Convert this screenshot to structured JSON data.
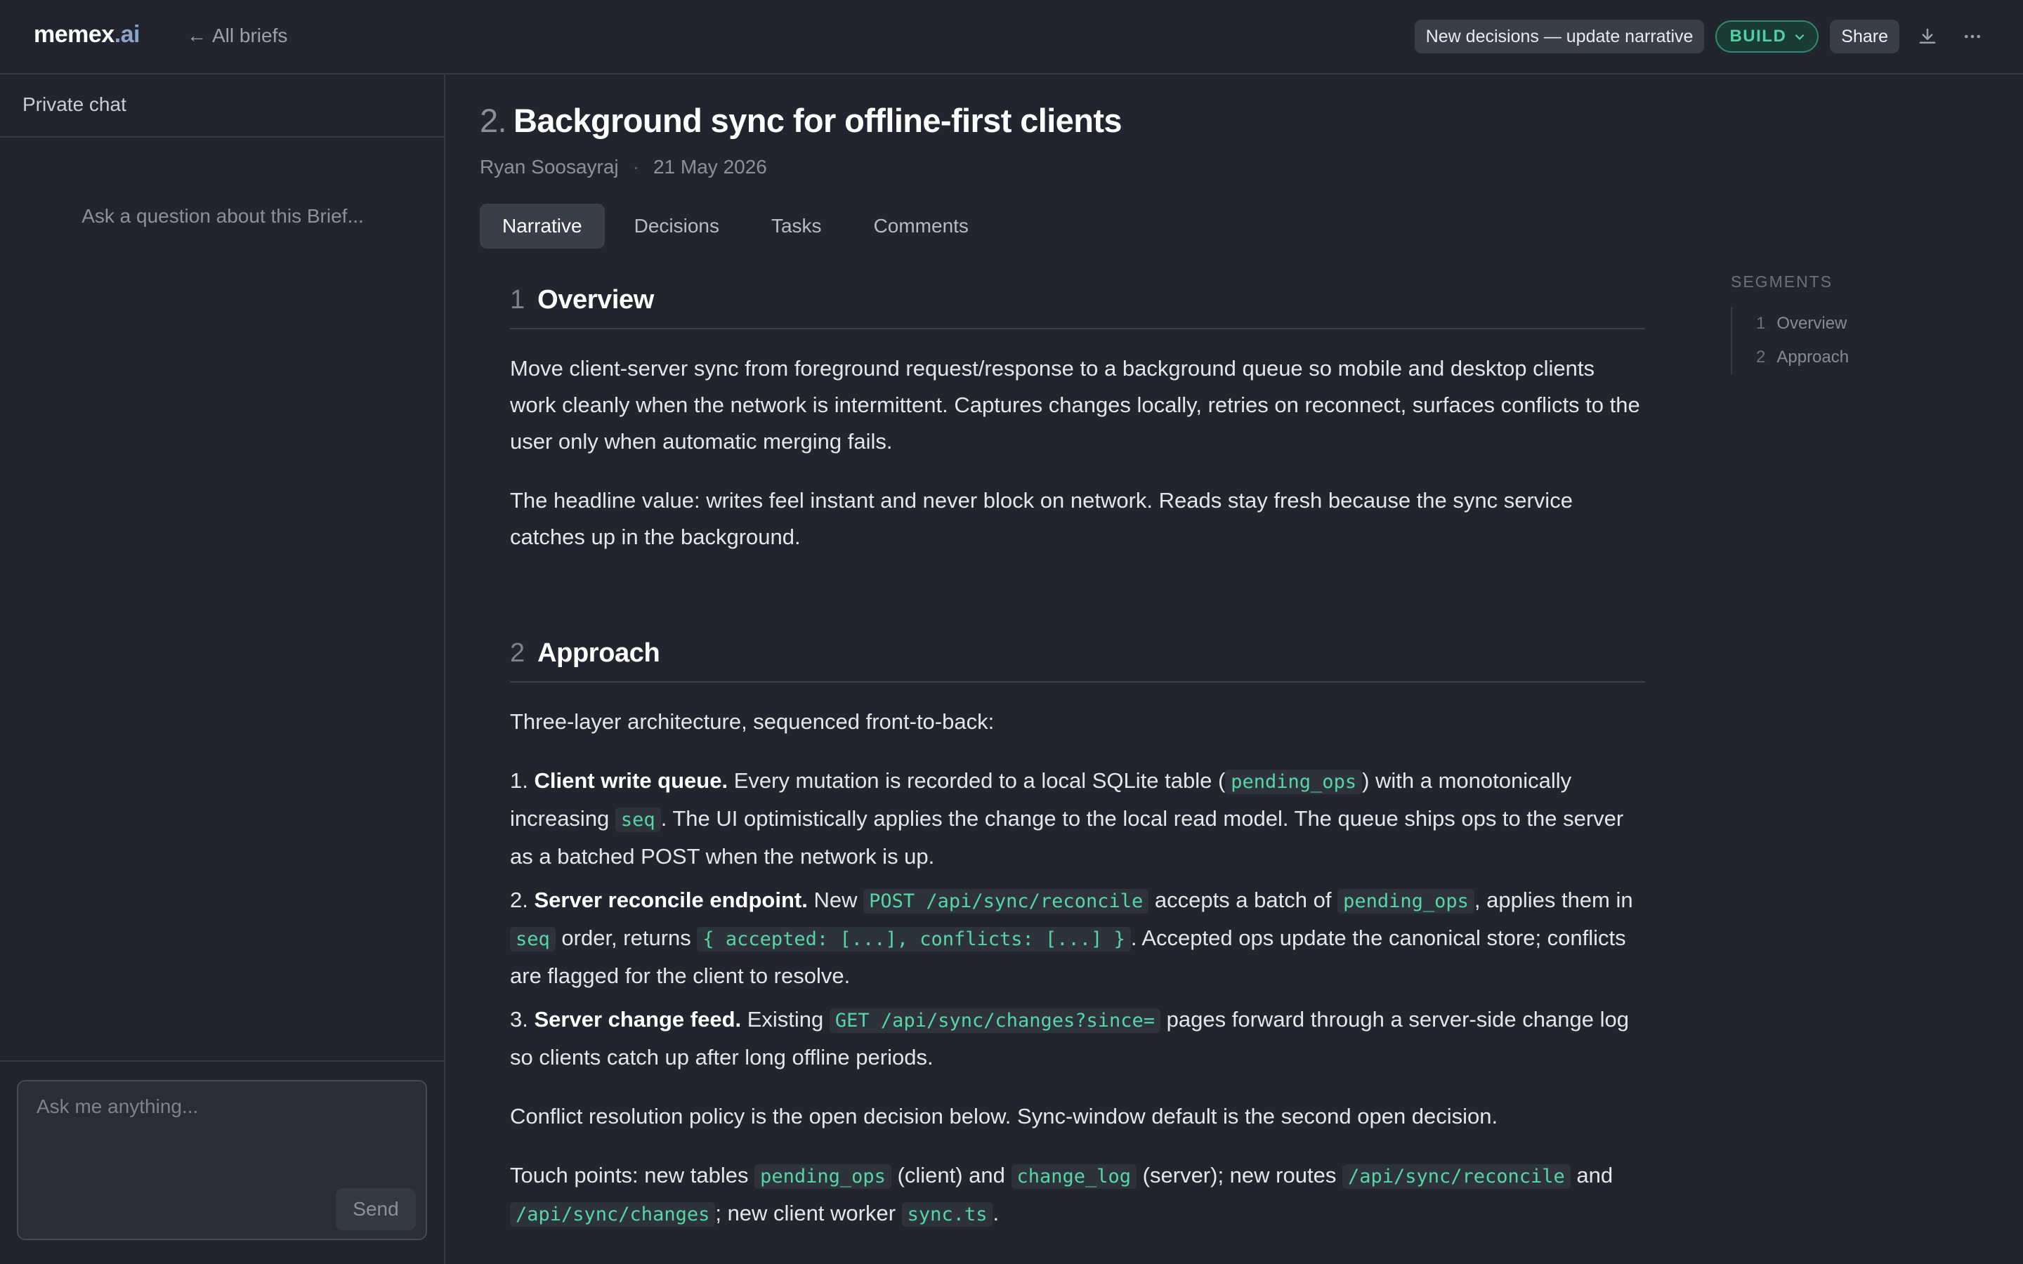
{
  "header": {
    "logo_main": "memex",
    "logo_accent": ".ai",
    "back_label": "All briefs",
    "notice_label": "New decisions — update narrative",
    "build_label": "BUILD",
    "share_label": "Share",
    "build_color": "#4fd1a2"
  },
  "sidebar": {
    "title": "Private chat",
    "empty_prompt": "Ask a question about this Brief...",
    "input_placeholder": "Ask me anything...",
    "send_label": "Send"
  },
  "brief": {
    "number": "2.",
    "title": "Background sync for offline-first clients",
    "author": "Ryan Soosayraj",
    "separator": "·",
    "date": "21 May 2026",
    "tabs": [
      "Narrative",
      "Decisions",
      "Tasks",
      "Comments"
    ],
    "active_tab": "Narrative"
  },
  "sections": [
    {
      "num": "1",
      "title": "Overview",
      "p1": "Move client-server sync from foreground request/response to a background queue so mobile and desktop clients work cleanly when the network is intermittent. Captures changes locally, retries on reconnect, surfaces conflicts to the user only when automatic merging fails.",
      "p2": "The headline value: writes feel instant and never block on network. Reads stay fresh because the sync service catches up in the background."
    },
    {
      "num": "2",
      "title": "Approach",
      "intro": "Three-layer architecture, sequenced front-to-back:",
      "item1": {
        "prefix": "1.",
        "bold": "Client write queue.",
        "t1": " Every mutation is recorded to a local SQLite table (",
        "c1": "pending_ops",
        "t2": ") with a monotonically increasing ",
        "c2": "seq",
        "t3": ". The UI optimistically applies the change to the local read model. The queue ships ops to the server as a batched POST when the network is up."
      },
      "item2": {
        "prefix": "2.",
        "bold": "Server reconcile endpoint.",
        "t1": " New ",
        "c1": "POST /api/sync/reconcile",
        "t2": " accepts a batch of ",
        "c2": "pending_ops",
        "t3": ", applies them in ",
        "c3": "seq",
        "t4": " order, returns ",
        "c4": "{ accepted: [...], conflicts: [...] }",
        "t5": ". Accepted ops update the canonical store; conflicts are flagged for the client to resolve."
      },
      "item3": {
        "prefix": "3.",
        "bold": "Server change feed.",
        "t1": " Existing ",
        "c1": "GET /api/sync/changes?since=",
        "t2": " pages forward through a server-side change log so clients catch up after long offline periods."
      },
      "p_conflict": "Conflict resolution policy is the open decision below. Sync-window default is the second open decision.",
      "touch": {
        "t1": "Touch points: new tables ",
        "c1": "pending_ops",
        "t2": " (client) and ",
        "c2": "change_log",
        "t3": " (server); new routes ",
        "c3": "/api/sync/reconcile",
        "t4": " and ",
        "c4": "/api/sync/changes",
        "t5": "; new client worker ",
        "c5": "sync.ts",
        "t6": "."
      }
    }
  ],
  "segments": {
    "label": "SEGMENTS",
    "items": [
      {
        "num": "1",
        "label": "Overview"
      },
      {
        "num": "2",
        "label": "Approach"
      }
    ]
  },
  "icons": {
    "back": "arrow-left-icon",
    "build_dropdown": "chevron-down-icon",
    "download": "download-icon",
    "more": "more-horizontal-icon"
  }
}
